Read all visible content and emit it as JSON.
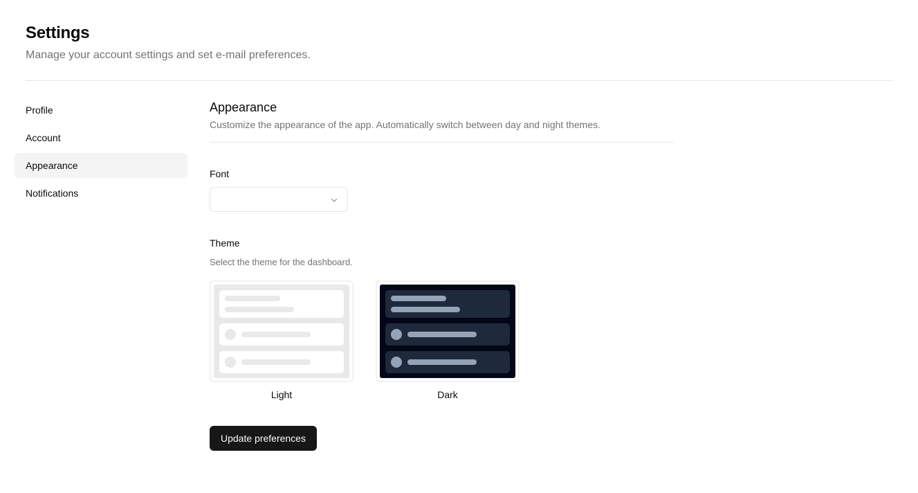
{
  "header": {
    "title": "Settings",
    "subtitle": "Manage your account settings and set e-mail preferences."
  },
  "sidebar": {
    "items": [
      {
        "label": "Profile",
        "active": false
      },
      {
        "label": "Account",
        "active": false
      },
      {
        "label": "Appearance",
        "active": true
      },
      {
        "label": "Notifications",
        "active": false
      }
    ]
  },
  "main": {
    "title": "Appearance",
    "description": "Customize the appearance of the app. Automatically switch between day and night themes.",
    "font": {
      "label": "Font",
      "value": "",
      "icon": "chevron-down-icon"
    },
    "theme": {
      "label": "Theme",
      "description": "Select the theme for the dashboard.",
      "options": [
        {
          "label": "Light",
          "colors": {
            "background": "#e9e9eb",
            "card": "#ffffff",
            "placeholder": "#e9e9eb"
          }
        },
        {
          "label": "Dark",
          "colors": {
            "background": "#020617",
            "card": "#1e293b",
            "placeholder": "#94a3b8"
          }
        }
      ]
    },
    "submit_label": "Update preferences"
  },
  "colors": {
    "primary_button": "#171717",
    "active_nav_bg": "#f4f4f5",
    "muted_text": "#737373",
    "border": "#e5e5e5"
  }
}
